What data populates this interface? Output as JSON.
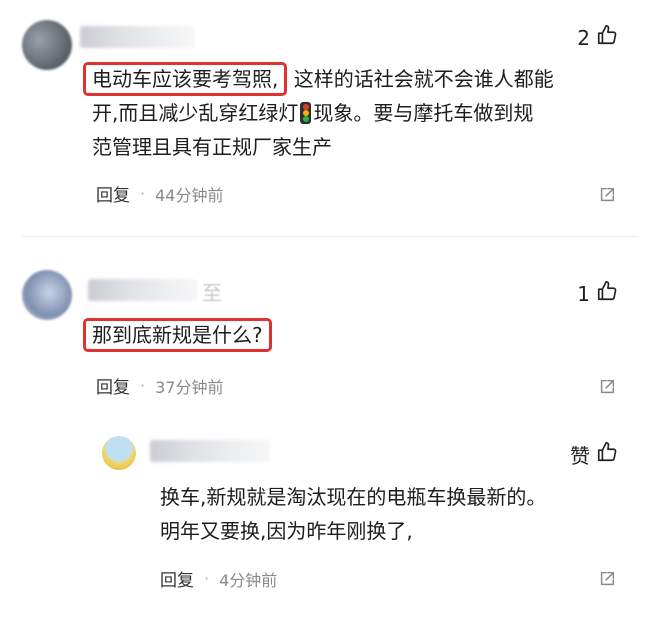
{
  "comments": [
    {
      "likes": "2",
      "highlight": "电动车应该要考驾照,",
      "line1_rest": "这样的话社会就不会谁人都能",
      "line2_a": "开,而且减少乱穿红绿灯",
      "emoji": "traffic-light-icon",
      "line2_b": "现象。要与摩托车做到规",
      "line3": "范管理且具有正规厂家生产",
      "reply_label": "回复",
      "separator": "·",
      "time": "44分钟前"
    },
    {
      "likes": "1",
      "name_fragment": "至",
      "highlight": "那到底新规是什么?",
      "reply_label": "回复",
      "separator": "·",
      "time": "37分钟前"
    },
    {
      "likes": "赞",
      "line1": "换车,新规就是淘汰现在的电瓶车换最新的。",
      "line2": "明年又要换,因为昨年刚换了,",
      "reply_label": "回复",
      "separator": "·",
      "time": "4分钟前"
    }
  ],
  "icons": {
    "like": "thumbs-up-icon",
    "share": "share-icon"
  },
  "colors": {
    "highlight_border": "#e0312f",
    "meta_text": "#8a8a8a"
  }
}
